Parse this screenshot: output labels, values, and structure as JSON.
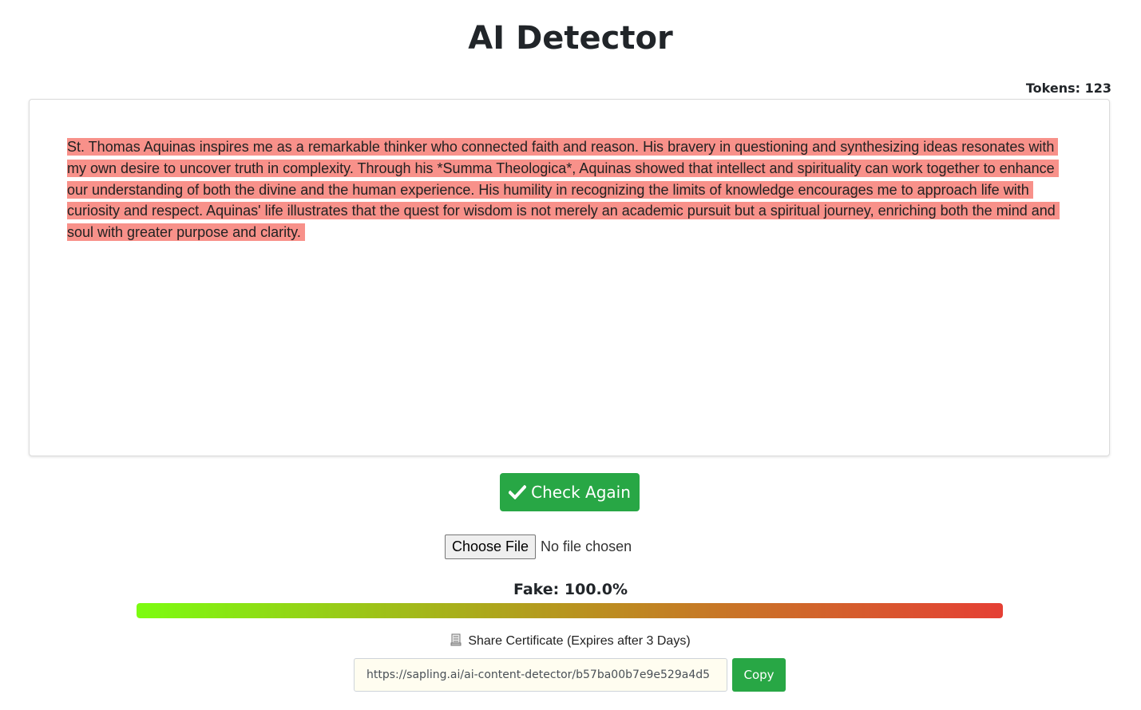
{
  "header": {
    "title": "AI Detector",
    "tokens_label": "Tokens: 123"
  },
  "editor": {
    "text": "St. Thomas Aquinas inspires me as a remarkable thinker who connected faith and reason. His bravery in questioning and synthesizing ideas resonates with my own desire to uncover truth in complexity. Through his *Summa Theologica*, Aquinas showed that intellect and spirituality can work together to enhance our understanding of both the divine and the human experience. His humility in recognizing the limits of knowledge encourages me to approach life with curiosity and respect. Aquinas' life illustrates that the quest for wisdom is not merely an academic pursuit but a spiritual journey, enriching both the mind and soul with greater purpose and clarity.",
    "highlight_color": "#f8918a"
  },
  "actions": {
    "check_again_label": "Check Again",
    "check_icon": "check-icon",
    "choose_file_label": "Choose File",
    "file_status": "No file chosen"
  },
  "result": {
    "fake_label": "Fake: 100.0%",
    "fake_fraction": 1.0,
    "gradient_colors": [
      "#7cfc10",
      "#b8941f",
      "#e53f34"
    ]
  },
  "share": {
    "icon": "scroll-icon",
    "label": "Share Certificate (Expires after 3 Days)",
    "url": "https://sapling.ai/ai-content-detector/b57ba00b7e9e529a4d5",
    "copy_label": "Copy"
  },
  "colors": {
    "accent_green": "#28a745",
    "text": "#212529"
  }
}
